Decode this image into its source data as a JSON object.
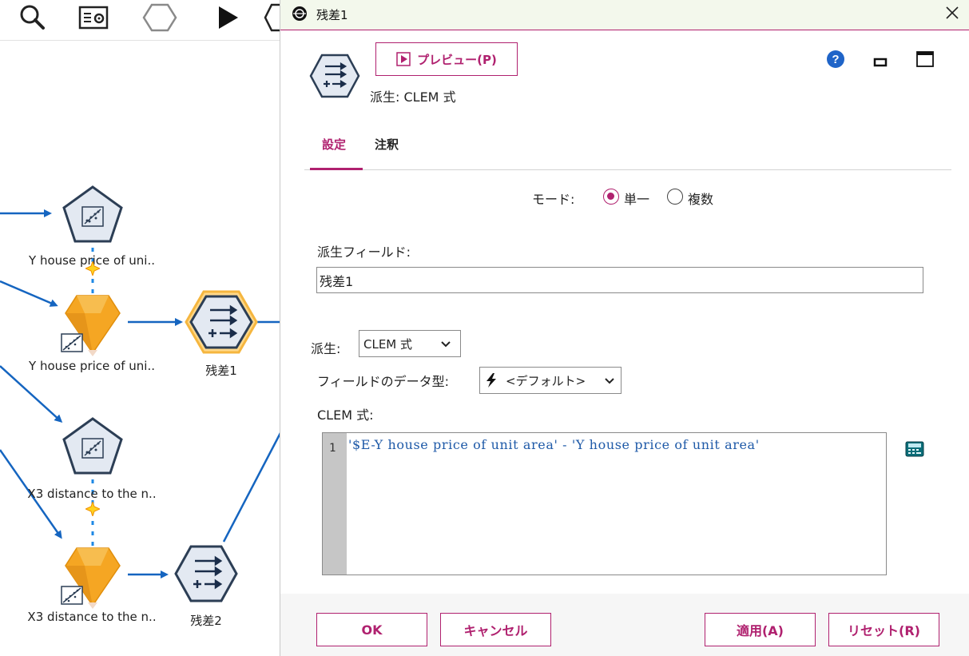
{
  "canvas": {
    "toolbar_icons": [
      "search-icon",
      "properties-icon",
      "hexagon-icon",
      "run-icon"
    ],
    "nodes": [
      {
        "label": "Y house price of uni..",
        "kind": "plot"
      },
      {
        "label": "Y house price of uni..",
        "kind": "model"
      },
      {
        "label": "残差1",
        "kind": "derive"
      },
      {
        "label": "X3 distance to the n..",
        "kind": "plot"
      },
      {
        "label": "X3 distance to the n..",
        "kind": "model"
      },
      {
        "label": "残差2",
        "kind": "derive"
      }
    ]
  },
  "dialog": {
    "title": "残差1",
    "preview_label": "プレビュー(P)",
    "node_type": "派生: CLEM 式",
    "tabs": [
      "設定",
      "注釈"
    ],
    "mode_label": "モード:",
    "mode_options": [
      "単一",
      "複数"
    ],
    "mode_selected": "単一",
    "derive_field_label": "派生フィールド:",
    "derive_field_value": "残差1",
    "derive_as_label": "派生:",
    "derive_as_value": "CLEM 式",
    "field_type_label": "フィールドのデータ型:",
    "field_type_value": "<デフォルト>",
    "clem_label": "CLEM 式:",
    "clem_line_number": "1",
    "clem_expression": "'$E-Y house price of unit area' - 'Y house price of unit area'",
    "buttons": {
      "ok": "OK",
      "cancel": "キャンセル",
      "apply": "適用(A)",
      "reset": "リセット(R)"
    },
    "accent_color": "#b0216f"
  }
}
